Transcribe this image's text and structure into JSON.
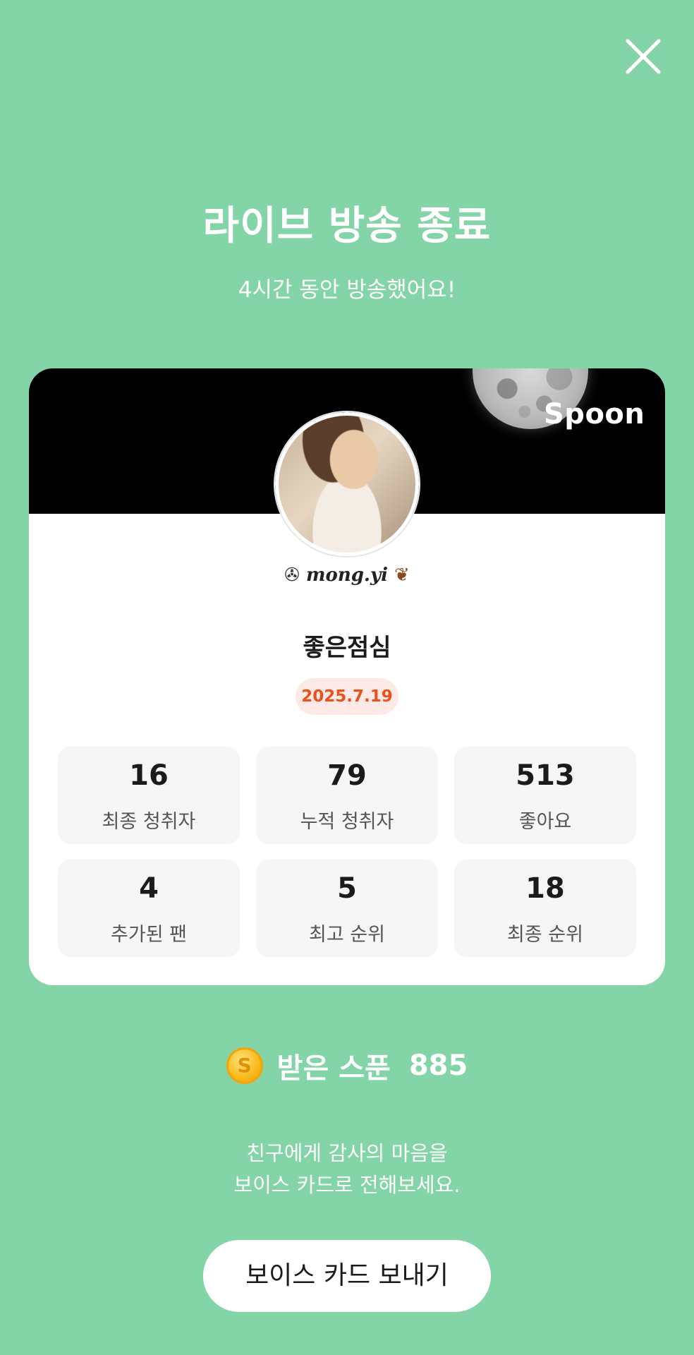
{
  "header": {
    "title": "라이브 방송 종료",
    "subtitle": "4시간 동안 방송했어요!"
  },
  "close_icon": "close-icon",
  "card": {
    "brand": "Spoon",
    "nickname": "mong.yi",
    "display_name": "좋은점심",
    "date": "2025.7.19",
    "stats": [
      {
        "value": "16",
        "label": "최종 청취자"
      },
      {
        "value": "79",
        "label": "누적 청취자"
      },
      {
        "value": "513",
        "label": "좋아요"
      },
      {
        "value": "4",
        "label": "추가된 팬"
      },
      {
        "value": "5",
        "label": "최고 순위"
      },
      {
        "value": "18",
        "label": "최종 순위"
      }
    ]
  },
  "spoons": {
    "coin_letter": "S",
    "label": "받은 스푼",
    "count": "885"
  },
  "message": {
    "line1": "친구에게 감사의 마음을",
    "line2": "보이스 카드로 전해보세요."
  },
  "cta": {
    "label": "보이스 카드 보내기"
  },
  "colors": {
    "background": "#83d4a6",
    "date_badge_text": "#e8521c",
    "date_badge_bg": "#fdeae6"
  }
}
